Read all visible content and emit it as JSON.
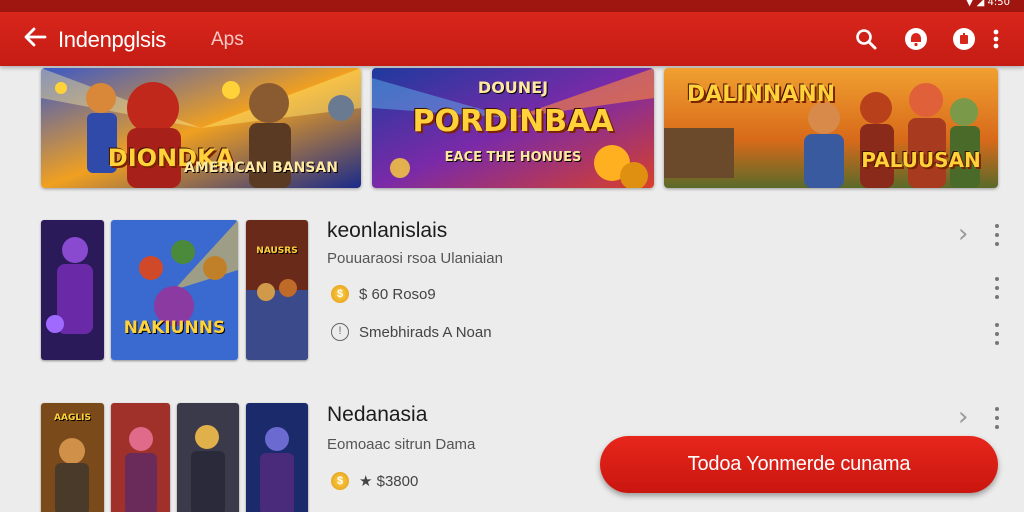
{
  "status_bar": {
    "indicators": "▼ ◢ 4:50"
  },
  "app_bar": {
    "title": "Indenpglsis",
    "subtitle": "Aps",
    "icons": [
      "back-arrow-icon",
      "search-icon",
      "notification-icon",
      "profile-icon",
      "more-vert-icon"
    ]
  },
  "banners": [
    {
      "logo": "DIONDKA",
      "tagline": "AMERICAN BANSAN"
    },
    {
      "logo": "PORDINBAA",
      "tagline": "EACE THE HONUES",
      "top_text": "DOUNEJ"
    },
    {
      "logo": "DALINNANN",
      "tagline": "PALUUSAN"
    }
  ],
  "list": [
    {
      "title": "keonlanislais",
      "subtitle": "Pouuaraosi rsoa Ulaniaian",
      "meta": [
        {
          "icon": "coin-icon",
          "icon_glyph": "$",
          "text": "$ 60 Roso9"
        },
        {
          "icon": "timer-icon",
          "icon_glyph": "!",
          "text": "Smebhirads A Noan"
        }
      ],
      "thumb_titles": [
        "",
        "NAKIUNNS",
        "NAUSRS"
      ]
    },
    {
      "title": "Nedanasia",
      "subtitle": "Eomoaac sitrun Dama",
      "meta": [
        {
          "icon": "coin-icon",
          "icon_glyph": "$",
          "text": "★ $3800"
        }
      ],
      "thumb_titles": [
        "AAGLIS",
        "",
        "",
        ""
      ]
    }
  ],
  "cta": {
    "label": "Todoa Yonmerde cunama"
  },
  "colors": {
    "primary": "#d9261c",
    "primary_dark": "#9f1610",
    "background": "#ececec",
    "accent_gold": "#ffcf4a"
  }
}
